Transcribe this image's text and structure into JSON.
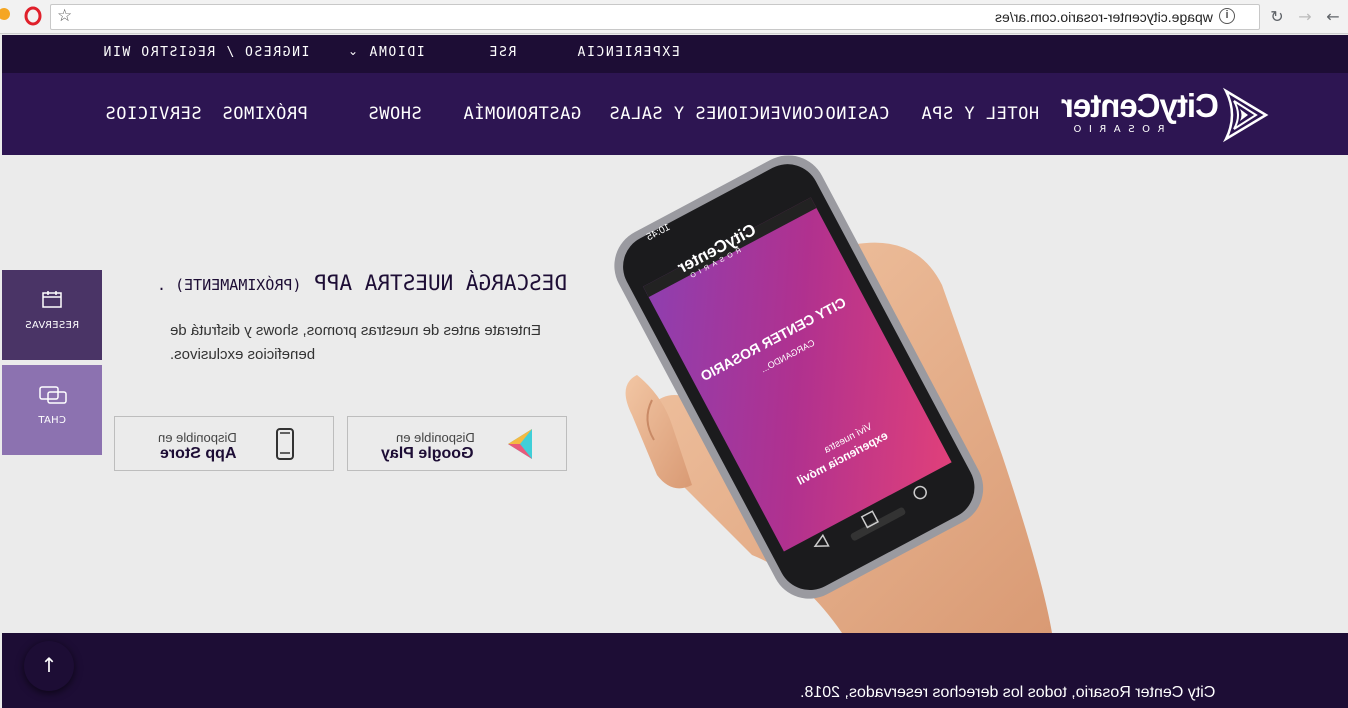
{
  "browser": {
    "url": "wpage.citycenter-rosario.com.ar/es",
    "back_icon": "arrow-left-icon",
    "forward_icon": "arrow-right-icon",
    "reload_icon": "reload-icon",
    "info_icon": "info-icon",
    "bookmark_icon": "star-icon",
    "opera_icon": "opera-icon"
  },
  "topbar": {
    "experiencia": "EXPERIENCIA",
    "rse": "RSE",
    "idioma": "IDIOMA",
    "ingreso": "INGRESO / REGISTRO WIN"
  },
  "logo": {
    "wordmark": "CityCenter",
    "sub": "ROSARIO"
  },
  "nav": {
    "items": [
      "HOTEL Y SPA",
      "CASINO",
      "CONVENCIONES Y SALAS",
      "GASTRONOMÍA",
      "SHOWS",
      "PRÓXIMOS",
      "SERVICIOS"
    ]
  },
  "hero": {
    "title": "DESCARGÁ NUESTRA APP",
    "title_small": "(PRÓXIMAMENTE) .",
    "description": "Enterate antes de nuestras promos, shows y disfrutá de beneficios exclusivos.",
    "google": {
      "small": "Disponible en",
      "big": "Google Play"
    },
    "apple": {
      "small": "Disponible en",
      "big": "App Store"
    },
    "phone": {
      "time": "10:45",
      "brand": "CityCenter",
      "brand_sub": "ROSARIO",
      "building_sign": "CITY CENTER ROSARIO",
      "loading": "CARGANDO...",
      "tagline_1": "Viví nuestra",
      "tagline_2": "experiencia móvil"
    }
  },
  "side": {
    "reservas": "RESERVAS",
    "chat": "CHAT"
  },
  "footer": {
    "copyright": "City Center Rosario, todos los derechos reservados, 2018."
  },
  "colors": {
    "dark_purple": "#1d0d35",
    "nav_purple": "#2d1552",
    "reservas_bg": "#4a3466",
    "chat_bg": "#8c72b0",
    "hero_bg": "#ebebeb"
  }
}
